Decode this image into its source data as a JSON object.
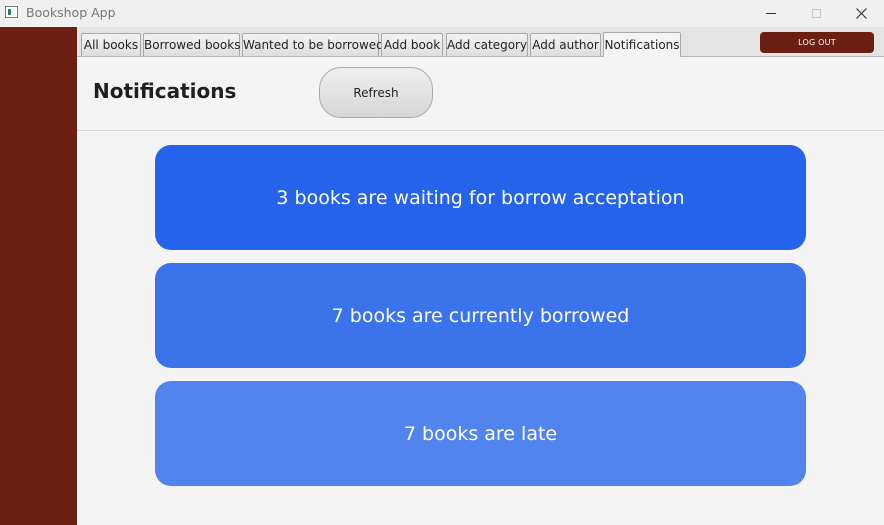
{
  "window": {
    "title": "Bookshop App"
  },
  "tabs": [
    {
      "label": "All books",
      "active": false
    },
    {
      "label": "Borrowed books",
      "active": false
    },
    {
      "label": "Wanted to be borrowed",
      "active": false
    },
    {
      "label": "Add book",
      "active": false
    },
    {
      "label": "Add category",
      "active": false
    },
    {
      "label": "Add author",
      "active": false
    },
    {
      "label": "Notifications",
      "active": true
    }
  ],
  "header": {
    "logout_label": "LOG OUT",
    "page_title": "Notifications",
    "refresh_label": "Refresh"
  },
  "notifications": [
    {
      "text": "3 books are waiting for borrow acceptation",
      "color": "#2563eb"
    },
    {
      "text": "7 books are currently borrowed",
      "color": "#3b74ea"
    },
    {
      "text": "7 books are late",
      "color": "#5284ee"
    }
  ],
  "colors": {
    "sidebar": "#6b1f13",
    "logout_button": "#6b1f13",
    "background": "#f4f4f5"
  },
  "icons": {
    "app": "app-window-icon",
    "minimize": "minimize-icon",
    "maximize": "maximize-icon",
    "close": "close-icon"
  }
}
